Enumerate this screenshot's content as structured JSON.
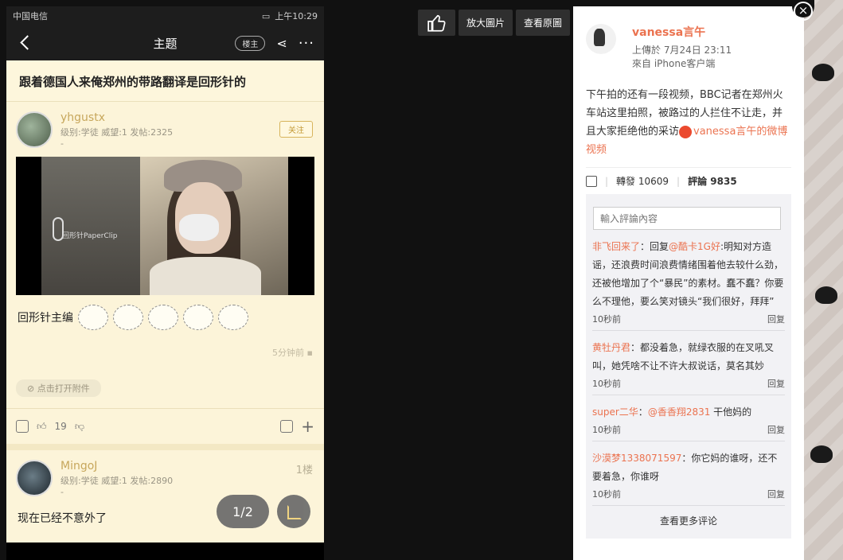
{
  "phone": {
    "status_carrier": "中国电信",
    "status_right": "上午10:29",
    "nav_title": "主题",
    "owner_badge": "楼主",
    "thread_title": "跟着德国人来俺郑州的带路翻译是回形针的",
    "post1": {
      "user": "yhgustx",
      "meta": "级别:学徒 威望:1 发帖:2325",
      "dash": "-",
      "follow": "关注",
      "video_watermark": "回形针PaperClip",
      "caption": "回形针主编",
      "time": "5分钟前",
      "attach": "点击打开附件",
      "likes": "19"
    },
    "post2": {
      "user": "MingoJ",
      "meta": "级别:学徒 威望:1 发帖:2890",
      "dash": "-",
      "floor": "1楼",
      "text": "现在已经不意外了"
    },
    "page_indicator": "1/2"
  },
  "toolbar": {
    "zoom": "放大圖片",
    "original": "查看原圖"
  },
  "close": "×",
  "weibo": {
    "name": "vanessa言午",
    "time": "上傳於 7月24日 23:11",
    "source": "來自 iPhone客户端",
    "text": "下午拍的还有一段视频，BBC记者在郑州火车站这里拍照，被路过的人拦住不让走，并且大家拒绝他的采访",
    "link": "vanessa言午的微博视频",
    "reposts": "轉發 10609",
    "comments_count": "評論 9835",
    "input_placeholder": "輸入評論內容",
    "comments": [
      {
        "user": "非飞回来了",
        "pre": "：回复",
        "at": "@酷卡1G好",
        "body": ":明知对方造谣，还浪费时间浪费情绪围着他去较什么劲，还被他增加了个“暴民”的素材。蠢不蠢？你要么不理他，要么笑对镜头“我们很好，拜拜”",
        "time": "10秒前",
        "reply": "回复"
      },
      {
        "user": "黄牡丹君",
        "pre": "：都没着急，就绿衣服的在叉吼叉叫，她凭啥不让不许大叔说话，莫名其妙",
        "at": "",
        "body": "",
        "time": "10秒前",
        "reply": "回复"
      },
      {
        "user": "super二华",
        "pre": "：",
        "at": "@香香翔2831",
        "body": " 干他妈的",
        "time": "10秒前",
        "reply": "回复"
      },
      {
        "user": "沙漠梦1338071597",
        "pre": "：你它妈的谁呀，还不要着急，你谁呀",
        "at": "",
        "body": "",
        "time": "10秒前",
        "reply": "回复"
      }
    ],
    "more": "查看更多评论"
  }
}
